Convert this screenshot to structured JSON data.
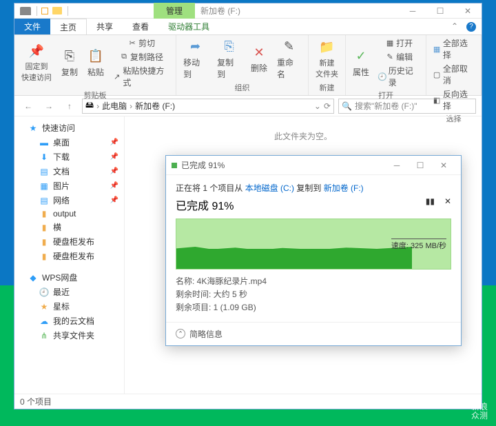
{
  "window": {
    "context_tab": "管理",
    "title": "新加卷 (F:)"
  },
  "tabs": {
    "file": "文件",
    "home": "主页",
    "share": "共享",
    "view": "查看",
    "tools": "驱动器工具"
  },
  "ribbon": {
    "pin": "固定到\n快速访问",
    "copy": "复制",
    "paste": "粘贴",
    "cut": "剪切",
    "copypath": "复制路径",
    "pasteshortcut": "粘贴快捷方式",
    "moveto": "移动到",
    "copyto": "复制到",
    "delete": "删除",
    "rename": "重命名",
    "newfolder": "新建\n文件夹",
    "properties": "属性",
    "open": "打开",
    "edit": "编辑",
    "history": "历史记录",
    "selectall": "全部选择",
    "selectnone": "全部取消",
    "invert": "反向选择",
    "grp_clip": "剪贴板",
    "grp_org": "组织",
    "grp_new": "新建",
    "grp_open": "打开",
    "grp_sel": "选择"
  },
  "path": {
    "root": "此电脑",
    "vol": "新加卷 (F:)"
  },
  "search": {
    "placeholder": "搜索\"新加卷 (F:)\""
  },
  "sidebar": {
    "quick": "快速访问",
    "desktop": "桌面",
    "downloads": "下载",
    "documents": "文档",
    "pictures": "图片",
    "network": "网络",
    "output": "output",
    "heng": "横",
    "disk1": "硬盘柜发布",
    "disk2": "硬盘柜发布",
    "wps": "WPS网盘",
    "recent": "最近",
    "star": "星标",
    "mycloud": "我的云文档",
    "share": "共享文件夹"
  },
  "content": {
    "empty": "此文件夹为空。"
  },
  "status": {
    "items": "0 个项目"
  },
  "dialog": {
    "title": "已完成 91%",
    "copying_prefix": "正在将 1 个项目从 ",
    "src": "本地磁盘 (C:)",
    "mid": " 复制到 ",
    "dst": "新加卷 (F:)",
    "progress": "已完成 91%",
    "speed": "速度: 325 MB/秒",
    "name": "名称:  4K海豚纪录片.mp4",
    "remain_time": "剩余时间:  大约 5 秒",
    "remain_items": "剩余项目:  1 (1.09 GB)",
    "details": "简略信息"
  },
  "watermark": {
    "l1": "新浪",
    "l2": "众测"
  }
}
